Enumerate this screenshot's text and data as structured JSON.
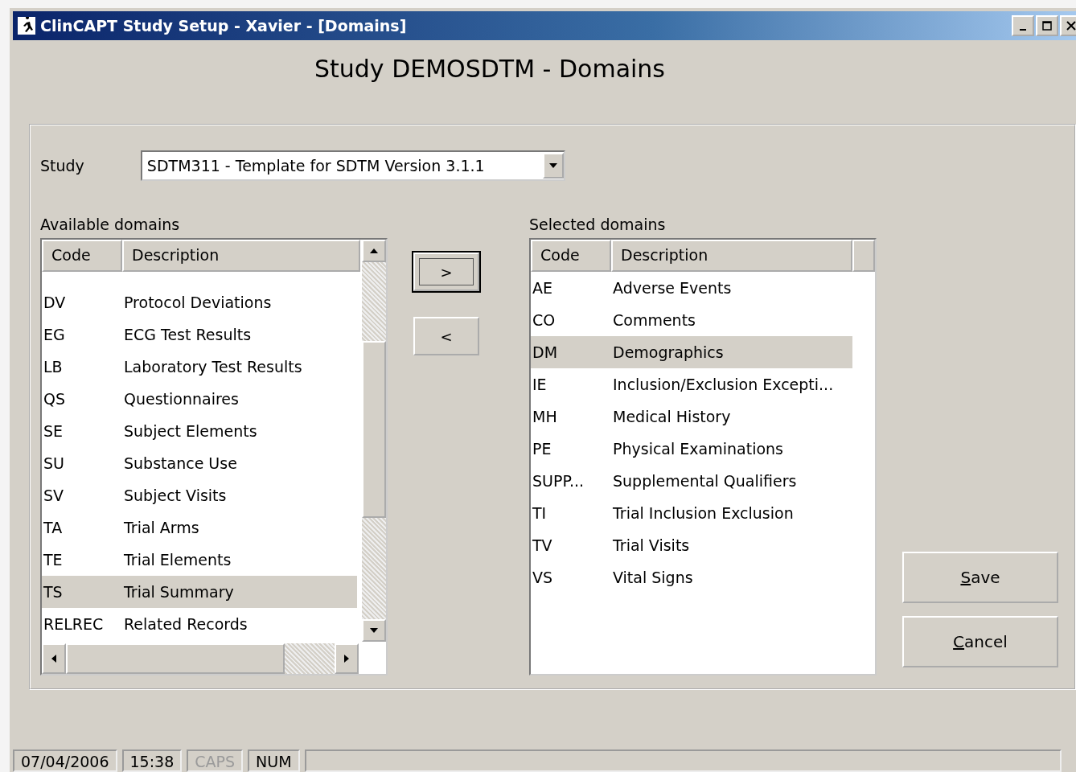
{
  "window": {
    "title": "ClinCAPT Study Setup - Xavier - [Domains]"
  },
  "heading": "Study DEMOSDTM - Domains",
  "study": {
    "label": "Study",
    "value": "SDTM311 - Template for SDTM Version 3.1.1"
  },
  "available": {
    "label": "Available domains",
    "columns": [
      "Code",
      "Description"
    ],
    "rows": [
      {
        "code": "DV",
        "description": "Protocol Deviations",
        "selected": false
      },
      {
        "code": "EG",
        "description": "ECG Test Results",
        "selected": false
      },
      {
        "code": "LB",
        "description": "Laboratory Test Results",
        "selected": false
      },
      {
        "code": "QS",
        "description": "Questionnaires",
        "selected": false
      },
      {
        "code": "SE",
        "description": "Subject Elements",
        "selected": false
      },
      {
        "code": "SU",
        "description": "Substance Use",
        "selected": false
      },
      {
        "code": "SV",
        "description": "Subject Visits",
        "selected": false
      },
      {
        "code": "TA",
        "description": "Trial Arms",
        "selected": false
      },
      {
        "code": "TE",
        "description": "Trial Elements",
        "selected": false
      },
      {
        "code": "TS",
        "description": "Trial Summary",
        "selected": true
      },
      {
        "code": "RELREC",
        "description": "Related Records",
        "selected": false
      }
    ]
  },
  "move_buttons": [
    {
      "label": ">",
      "focused": true
    },
    {
      "label": "<",
      "focused": false
    }
  ],
  "selected_domains": {
    "label": "Selected domains",
    "columns": [
      "Code",
      "Description"
    ],
    "rows": [
      {
        "code": "AE",
        "description": "Adverse Events",
        "selected": false
      },
      {
        "code": "CO",
        "description": "Comments",
        "selected": false
      },
      {
        "code": "DM",
        "description": "Demographics",
        "selected": true
      },
      {
        "code": "IE",
        "description": "Inclusion/Exclusion Excepti...",
        "selected": false
      },
      {
        "code": "MH",
        "description": "Medical History",
        "selected": false
      },
      {
        "code": "PE",
        "description": "Physical Examinations",
        "selected": false
      },
      {
        "code": "SUPP...",
        "description": "Supplemental Qualifiers",
        "selected": false
      },
      {
        "code": "TI",
        "description": "Trial Inclusion Exclusion",
        "selected": false
      },
      {
        "code": "TV",
        "description": "Trial Visits",
        "selected": false
      },
      {
        "code": "VS",
        "description": "Vital Signs",
        "selected": false
      }
    ]
  },
  "buttons": [
    {
      "label": "Save"
    },
    {
      "label": "Cancel"
    }
  ],
  "status_bar": [
    {
      "text": "07/04/2006",
      "on": true
    },
    {
      "text": "15:38",
      "on": true
    },
    {
      "text": "CAPS",
      "on": false
    },
    {
      "text": "NUM",
      "on": true
    }
  ]
}
